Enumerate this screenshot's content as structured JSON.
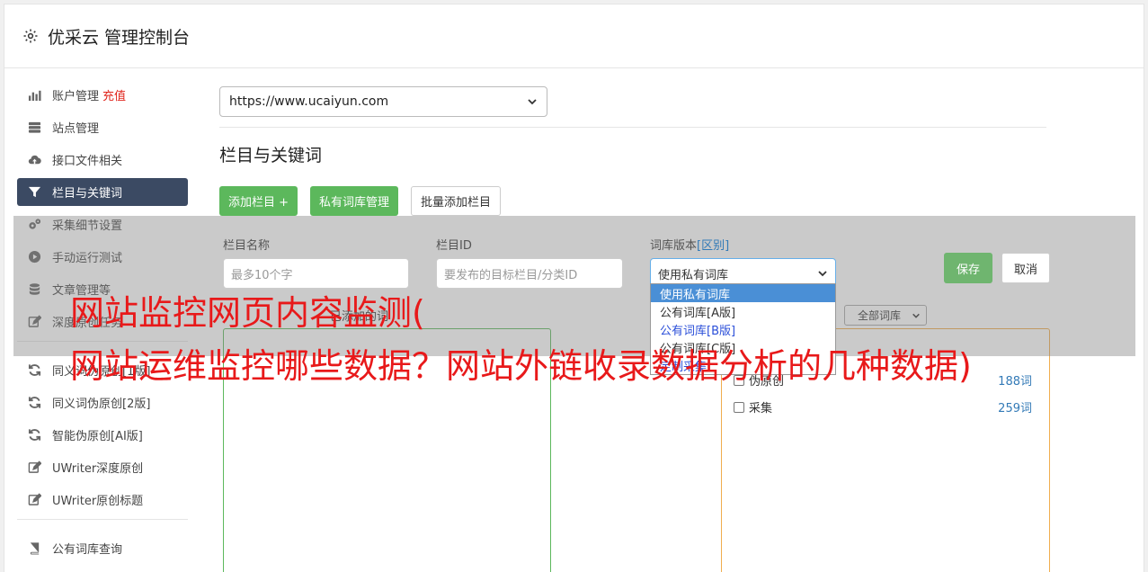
{
  "header": {
    "title": "优采云 管理控制台"
  },
  "sidebar": {
    "items": [
      {
        "label": "账户管理",
        "extra": "充值"
      },
      {
        "label": "站点管理"
      },
      {
        "label": "接口文件相关"
      },
      {
        "label": "栏目与关键词"
      },
      {
        "label": "采集细节设置"
      },
      {
        "label": "手动运行测试"
      },
      {
        "label": "文章管理等"
      },
      {
        "label": "深度原创任务"
      },
      {
        "label": "同义词伪原创[1版]"
      },
      {
        "label": "同义词伪原创[2版]"
      },
      {
        "label": "智能伪原创[AI版]"
      },
      {
        "label": "UWriter深度原创"
      },
      {
        "label": "UWriter原创标题"
      },
      {
        "label": "公有词库查询"
      }
    ]
  },
  "main": {
    "site_select": "https://www.ucaiyun.com",
    "section_title": "栏目与关键词",
    "buttons": {
      "add_column": "添加栏目 +",
      "private_lib": "私有词库管理",
      "batch_add": "批量添加栏目"
    },
    "form": {
      "name_label": "栏目名称",
      "name_placeholder": "最多10个字",
      "id_label": "栏目ID",
      "id_placeholder": "要发布的目标栏目/分类ID",
      "lib_label": "词库版本",
      "lib_label_link": "[区别]",
      "lib_value": "使用私有词库",
      "save": "保存",
      "cancel": "取消"
    },
    "lib_options": [
      "使用私有词库",
      "公有词库[A版]",
      "公有词库[B版]",
      "公有词库[C版]",
      "定制采集"
    ],
    "mid_label": "已添加的词",
    "lib_filter": "全部词库",
    "lib_rows": [
      {
        "name": "伪原创",
        "count": "188词"
      },
      {
        "name": "采集",
        "count": "259词"
      }
    ]
  },
  "overlay_title": {
    "line1": "网站监控网页内容监测(",
    "line2": "网站运维监控哪些数据？网站外链收录数据分析的几种数据)"
  }
}
